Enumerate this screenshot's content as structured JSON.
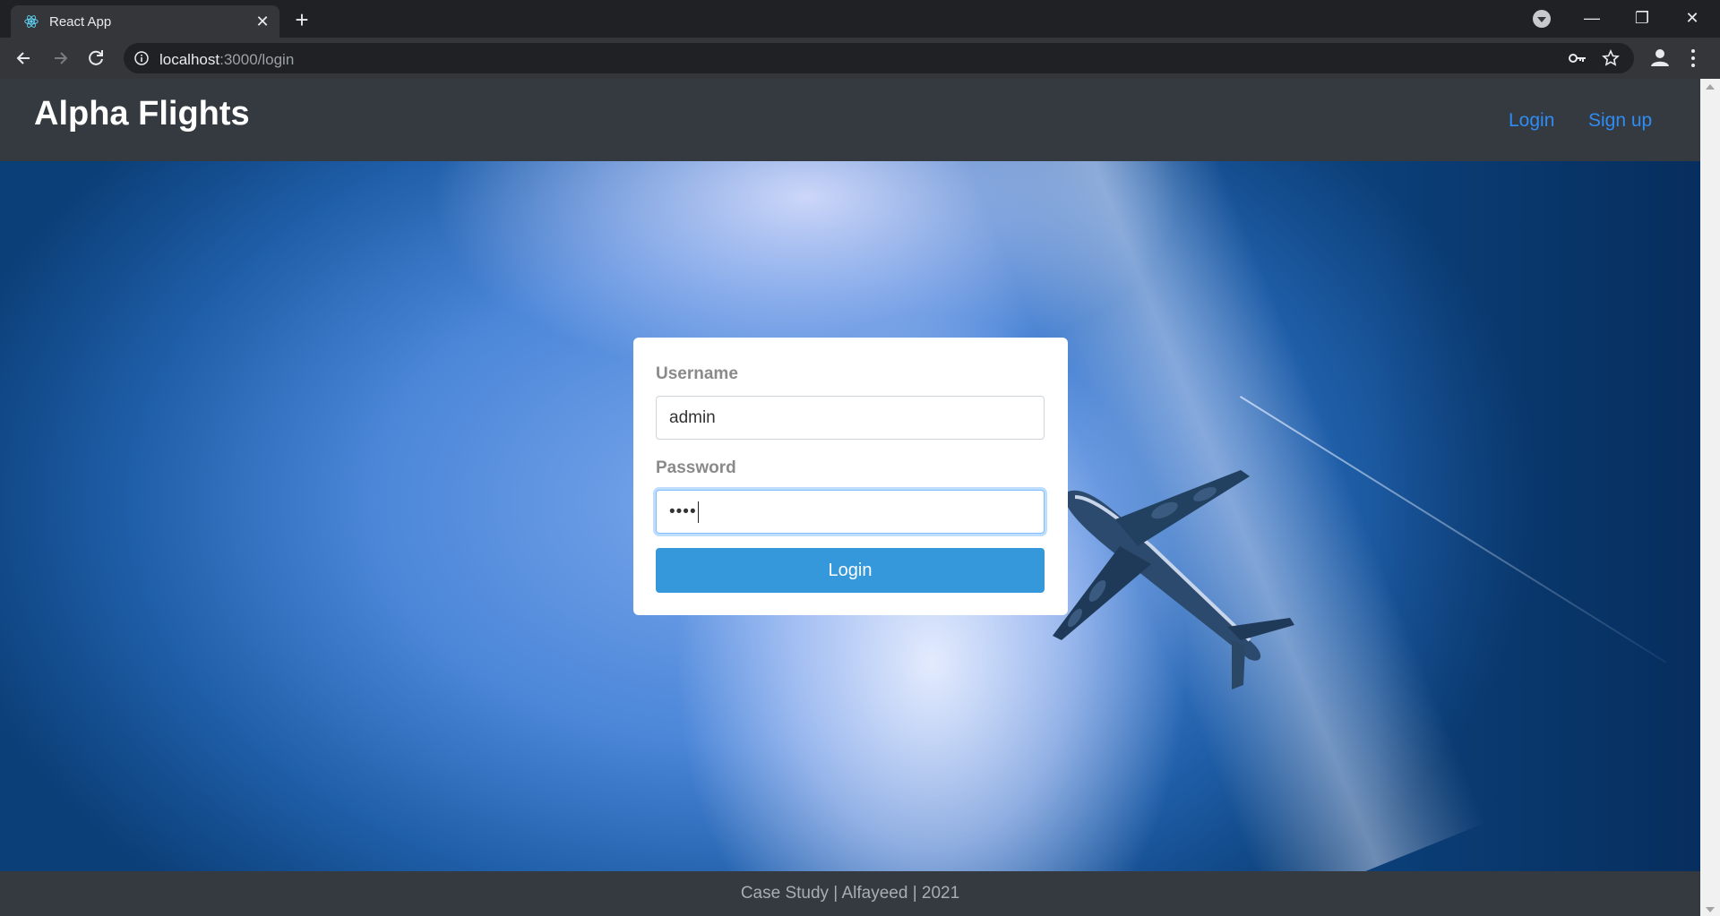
{
  "browser": {
    "tab_title": "React App",
    "url_host": "localhost",
    "url_rest": ":3000/login"
  },
  "navbar": {
    "brand": "Alpha Flights",
    "links": [
      {
        "label": "Login"
      },
      {
        "label": "Sign up"
      }
    ]
  },
  "form": {
    "username_label": "Username",
    "username_value": "admin",
    "password_label": "Password",
    "password_value": "••••",
    "submit_label": "Login"
  },
  "footer": {
    "text": "Case Study | Alfayeed | 2021"
  },
  "colors": {
    "navbar": "#343a40",
    "link": "#2f8cf5",
    "button": "#3498db"
  }
}
